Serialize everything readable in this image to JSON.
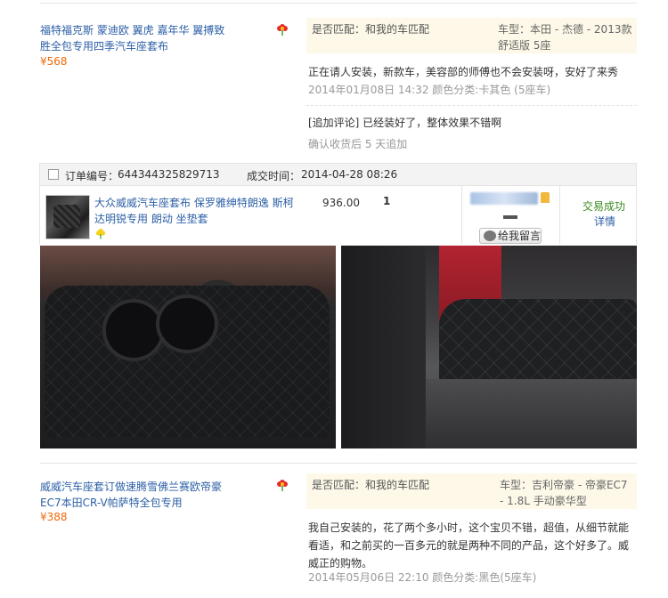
{
  "review1": {
    "product_title": "福特福克斯 蒙迪欧 翼虎 嘉年华 翼搏致胜全包专用四季汽车座套布",
    "price": "¥568",
    "match_label": "是否匹配：和我的车匹配",
    "car_model": "车型：本田 - 杰德 - 2013款 舒适版 5座",
    "text": "正在请人安装，新款车，美容部的师傅也不会安装呀，安好了来秀",
    "meta": "2014年01月08日 14:32 颜色分类:卡其色 (5座车)",
    "followup": "[追加评论] 已经装好了，整体效果不错啊",
    "followup_meta": "确认收货后 5 天追加"
  },
  "order": {
    "number_label": "订单编号：",
    "number": "644344325829713",
    "time_label": "成交时间：",
    "time": "2014-04-28 08:26",
    "product_title": "大众威威汽车座套布 保罗雅绅特朗逸 斯柯达明锐专用 朗动 坐垫套",
    "price": "936.00",
    "quantity": "1",
    "message_button": "给我留言",
    "status": "交易成功",
    "detail_link": "详情"
  },
  "review2": {
    "product_title": "威威汽车座套订做速腾雪佛兰赛欧帝豪EC7本田CR-V帕萨特全包专用",
    "price": "¥388",
    "match_label": "是否匹配：和我的车匹配",
    "car_model": "车型：吉利帝豪 - 帝豪EC7 - 1.8L 手动豪华型",
    "text": "我自己安装的，花了两个多小时，这个宝贝不错，超值，从细节就能看适，和之前买的一百多元的就是两种不同的产品，这个好多了。威威正的购物。",
    "meta": "2014年05月06日 22:10 颜色分类:黑色(5座车)"
  },
  "colors": {
    "link": "#2c5fa6",
    "price": "#f06a0b",
    "match_bg": "#fdf8e8",
    "status_green": "#3a8a1e"
  },
  "icons": [
    "flower-icon",
    "checkbox",
    "crown-icon",
    "message-bubble-icon",
    "flower-badge-icon"
  ]
}
